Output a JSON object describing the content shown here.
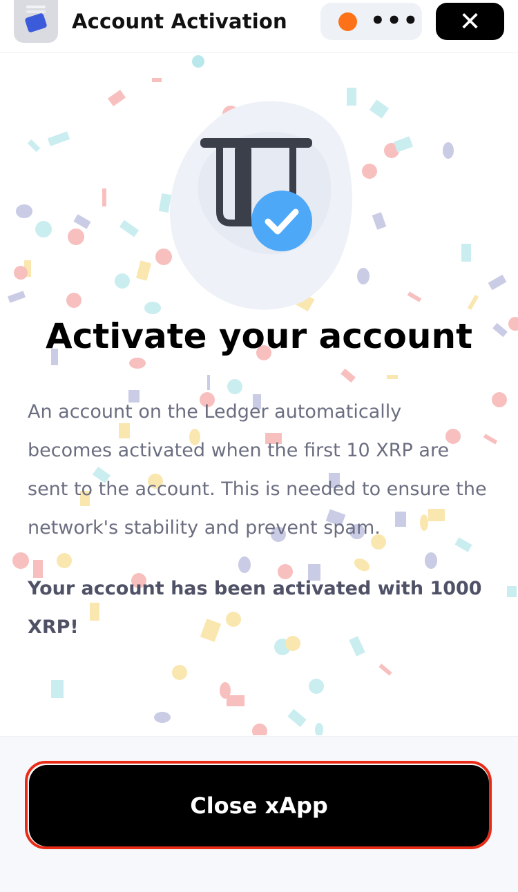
{
  "header": {
    "title": "Account Activation",
    "menu_dots": "•••",
    "close_glyph": "✕",
    "status_color": "#fd7219"
  },
  "main": {
    "headline": "Activate your account",
    "description": "An account on the Ledger automatically becomes activated when the first 10 XRP are sent to the account. This is needed to ensure the network's stability and prevent spam.",
    "status_message": "Your account has been activated with 1000 XRP!"
  },
  "footer": {
    "primary_button_label": "Close xApp"
  },
  "icons": [
    "app-icon",
    "more-icon",
    "close-icon",
    "card-reader-icon",
    "checkmark-icon",
    "confetti"
  ],
  "colors": {
    "accent": "#4da8f7",
    "button": "#000000",
    "highlight": "#e82b17"
  }
}
